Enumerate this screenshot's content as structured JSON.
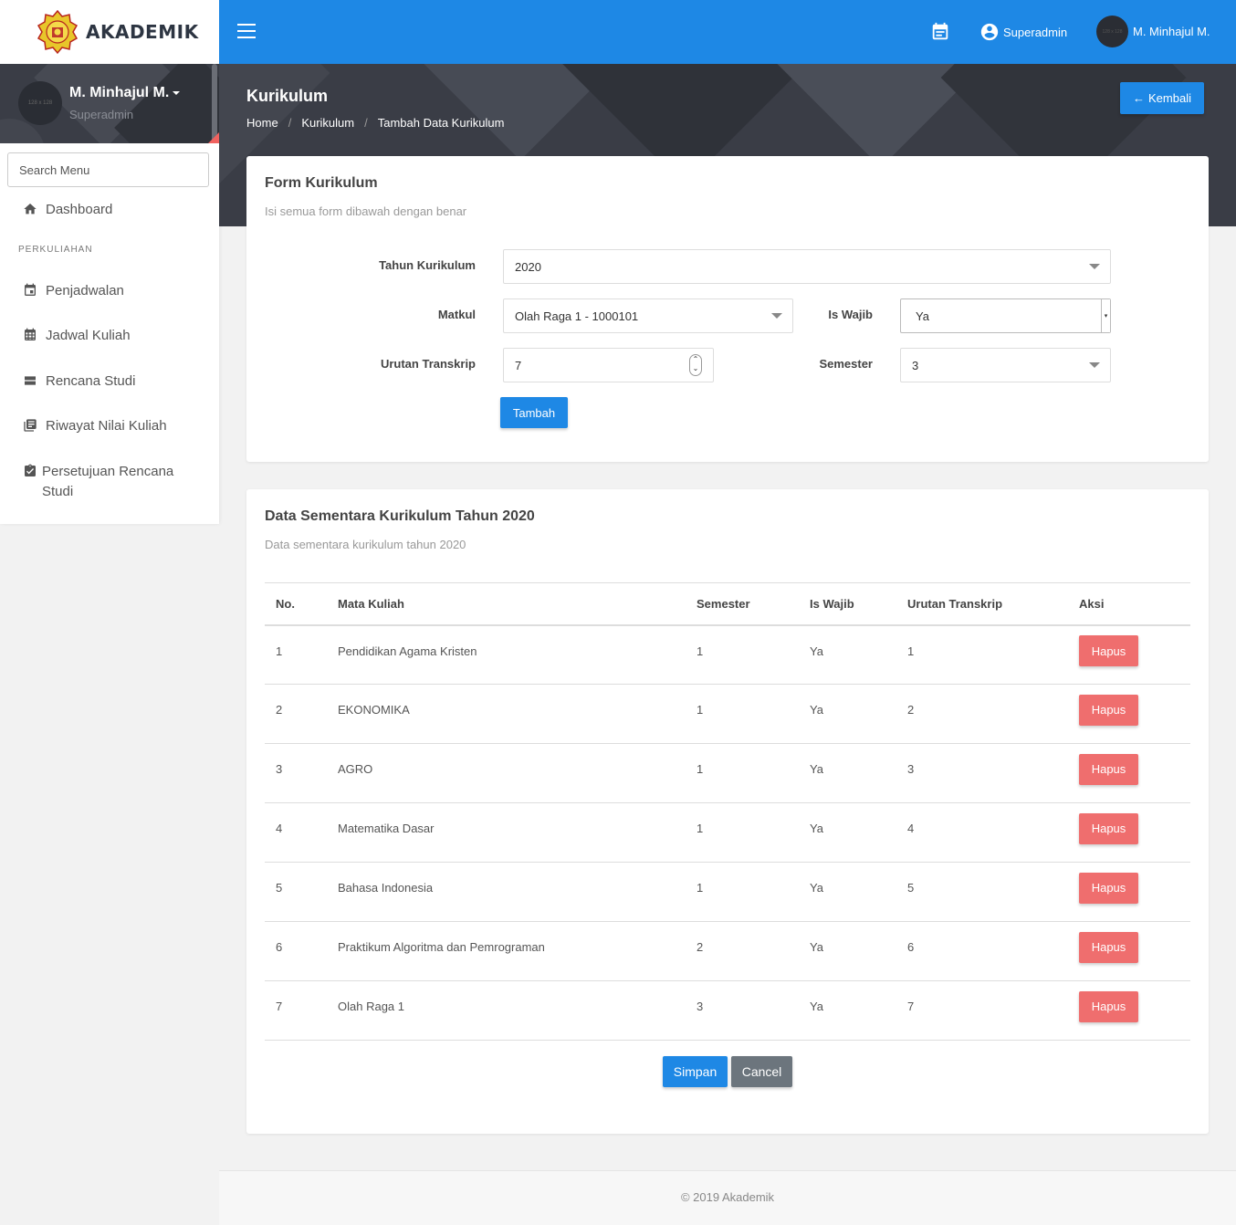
{
  "brand": {
    "name": "AKADEMIK"
  },
  "user_panel": {
    "name": "M. Minhajul M.",
    "role": "Superadmin",
    "avatar_text": "128 x 128"
  },
  "sidebar": {
    "search_placeholder": "Search Menu",
    "dashboard": "Dashboard",
    "section_header": "PERKULIAHAN",
    "items": [
      {
        "label": "Penjadwalan",
        "icon": "calendar-event-icon"
      },
      {
        "label": "Jadwal Kuliah",
        "icon": "calendar-grid-icon"
      },
      {
        "label": "Rencana Studi",
        "icon": "list-icon"
      },
      {
        "label": "Riwayat Nilai Kuliah",
        "icon": "library-books-icon"
      },
      {
        "label": "Persetujuan Rencana Studi",
        "icon": "clipboard-check-icon"
      }
    ]
  },
  "topbar": {
    "role_label": "Superadmin",
    "user_name": "M. Minhajul M.",
    "avatar_text": "128 x 128"
  },
  "page": {
    "title": "Kurikulum",
    "breadcrumb": [
      "Home",
      "Kurikulum",
      "Tambah Data Kurikulum"
    ],
    "back_button": "Kembali"
  },
  "form": {
    "title": "Form Kurikulum",
    "subtitle": "Isi semua form dibawah dengan benar",
    "tahun_label": "Tahun Kurikulum",
    "tahun_value": "2020",
    "matkul_label": "Matkul",
    "matkul_value": "Olah Raga 1 - 1000101",
    "wajib_label": "Is Wajib",
    "wajib_value": "Ya",
    "urutan_label": "Urutan Transkrip",
    "urutan_value": "7",
    "semester_label": "Semester",
    "semester_value": "3",
    "submit": "Tambah"
  },
  "data_table": {
    "title": "Data Sementara Kurikulum Tahun 2020",
    "subtitle": "Data sementara kurikulum tahun 2020",
    "columns": [
      "No.",
      "Mata Kuliah",
      "Semester",
      "Is Wajib",
      "Urutan Transkrip",
      "Aksi"
    ],
    "rows": [
      {
        "no": "1",
        "matkul": "Pendidikan Agama Kristen",
        "semester": "1",
        "wajib": "Ya",
        "urutan": "1",
        "aksi": "Hapus"
      },
      {
        "no": "2",
        "matkul": "EKONOMIKA",
        "semester": "1",
        "wajib": "Ya",
        "urutan": "2",
        "aksi": "Hapus"
      },
      {
        "no": "3",
        "matkul": "AGRO",
        "semester": "1",
        "wajib": "Ya",
        "urutan": "3",
        "aksi": "Hapus"
      },
      {
        "no": "4",
        "matkul": "Matematika Dasar",
        "semester": "1",
        "wajib": "Ya",
        "urutan": "4",
        "aksi": "Hapus"
      },
      {
        "no": "5",
        "matkul": "Bahasa Indonesia",
        "semester": "1",
        "wajib": "Ya",
        "urutan": "5",
        "aksi": "Hapus"
      },
      {
        "no": "6",
        "matkul": "Praktikum Algoritma dan Pemrograman",
        "semester": "2",
        "wajib": "Ya",
        "urutan": "6",
        "aksi": "Hapus"
      },
      {
        "no": "7",
        "matkul": "Olah Raga 1",
        "semester": "3",
        "wajib": "Ya",
        "urutan": "7",
        "aksi": "Hapus"
      }
    ],
    "save": "Simpan",
    "cancel": "Cancel"
  },
  "footer": "© 2019 Akademik",
  "colors": {
    "primary": "#1e88e5",
    "danger": "#ef6e6e",
    "secondary": "#6c757d",
    "dark_band": "#3a3d46"
  }
}
